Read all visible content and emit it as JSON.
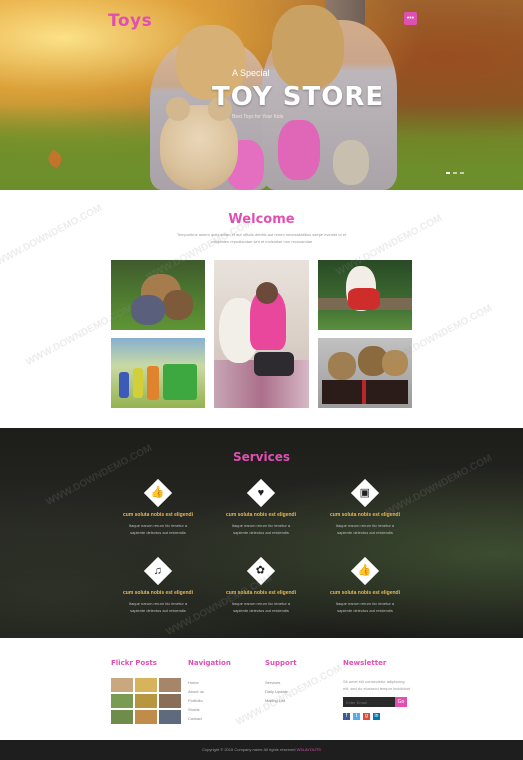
{
  "brand": {
    "logo": "Toys",
    "accent": "#e04fb2",
    "menu_icon": "menu-dots-icon"
  },
  "hero": {
    "kicker": "A Special",
    "title": "TOY STORE",
    "caption": "Best Toys for Your Kids"
  },
  "welcome": {
    "title": "Welcome",
    "text": "Temporibus autem quibusdam et aut officiis debitis aut rerum necessitatibus saepe eveniet ut et voluptates repudiandae sint et molestiae non recusandae"
  },
  "services": {
    "title": "Services",
    "items": [
      {
        "icon": "thumbs-up-icon",
        "glyph": "👍",
        "title": "cum soluta nobis est eligendi",
        "text": "Itaque earum rerum hic tenetur a sapiente delectus aut reiciendis"
      },
      {
        "icon": "heart-icon",
        "glyph": "♥",
        "title": "cum soluta nobis est eligendi",
        "text": "Itaque earum rerum hic tenetur a sapiente delectus aut reiciendis"
      },
      {
        "icon": "image-icon",
        "glyph": "▣",
        "title": "cum soluta nobis est eligendi",
        "text": "Itaque earum rerum hic tenetur a sapiente delectus aut reiciendis"
      },
      {
        "icon": "music-icon",
        "glyph": "♫",
        "title": "cum soluta nobis est eligendi",
        "text": "Itaque earum rerum hic tenetur a sapiente delectus aut reiciendis"
      },
      {
        "icon": "gift-icon",
        "glyph": "✿",
        "title": "cum soluta nobis est eligendi",
        "text": "Itaque earum rerum hic tenetur a sapiente delectus aut reiciendis"
      },
      {
        "icon": "thumbs-up-icon",
        "glyph": "👍",
        "title": "cum soluta nobis est eligendi",
        "text": "Itaque earum rerum hic tenetur a sapiente delectus aut reiciendis"
      }
    ]
  },
  "footer": {
    "flickr_title": "Flickr Posts",
    "navigation": {
      "title": "Navigation",
      "links": [
        "Home",
        "About us",
        "Portfolio",
        "Shorts",
        "Contact"
      ]
    },
    "support": {
      "title": "Support",
      "links": [
        "Services",
        "Daily Update",
        "Mailing List"
      ]
    },
    "newsletter": {
      "title": "Newsletter",
      "text": "Sit amet elit consectetur adipiscing elit, sed do eiusmod tempor incididunt",
      "placeholder": "Enter Email",
      "submit": "Go",
      "social": [
        "f",
        "t",
        "g",
        "in"
      ],
      "social_colors": [
        "#3b5998",
        "#55acee",
        "#dd4b39",
        "#0077b5"
      ]
    },
    "copyright": "Copyright © 2015 Company name All rights reserved",
    "copyright_link": "W3LAYOUTS"
  }
}
